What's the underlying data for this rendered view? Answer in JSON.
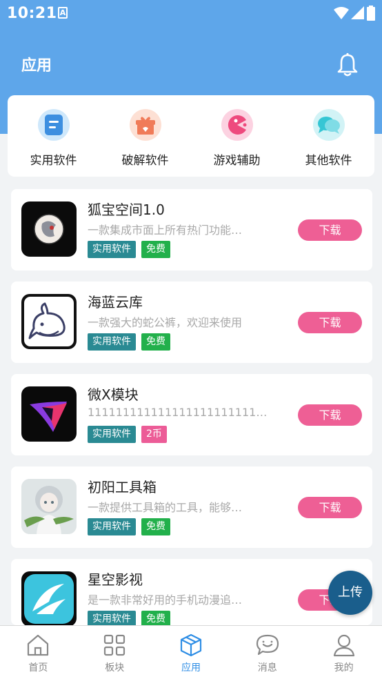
{
  "status_bar": {
    "time": "10:21",
    "notif_icon": "A"
  },
  "header": {
    "title": "应用"
  },
  "categories": [
    {
      "label": "实用软件",
      "icon": "doc-icon",
      "color": "#3d8fe0",
      "bg": "#cfe8fb"
    },
    {
      "label": "破解软件",
      "icon": "gift-icon",
      "color": "#f07b58",
      "bg": "#fde0d4"
    },
    {
      "label": "游戏辅助",
      "icon": "game-icon",
      "color": "#ee4a7e",
      "bg": "#fcd2e1"
    },
    {
      "label": "其他软件",
      "icon": "chat-icon",
      "color": "#35c6d4",
      "bg": "#d2f3f6"
    }
  ],
  "apps": [
    {
      "name": "狐宝空间1.0",
      "desc": "一款集成市面上所有热门功能…",
      "tag_category": "实用软件",
      "tag_price": "免费",
      "price_type": "free",
      "button": "下载"
    },
    {
      "name": "海蓝云库",
      "desc": "一款强大的蛇公裤，欢迎来使用",
      "tag_category": "实用软件",
      "tag_price": "免费",
      "price_type": "free",
      "button": "下载"
    },
    {
      "name": "微X模块",
      "desc": "1111111111111111111111111…",
      "tag_category": "实用软件",
      "tag_price": "2币",
      "price_type": "coin",
      "button": "下载"
    },
    {
      "name": "初阳工具箱",
      "desc": "一款提供工具箱的工具，能够…",
      "tag_category": "实用软件",
      "tag_price": "免费",
      "price_type": "free",
      "button": "下载"
    },
    {
      "name": "星空影视",
      "desc": "是一款非常好用的手机动漫追…",
      "tag_category": "实用软件",
      "tag_price": "免费",
      "price_type": "free",
      "button": "下载"
    }
  ],
  "fab": {
    "label": "上传"
  },
  "nav": [
    {
      "label": "首页",
      "icon": "home-icon",
      "active": false
    },
    {
      "label": "板块",
      "icon": "grid-icon",
      "active": false
    },
    {
      "label": "应用",
      "icon": "box-icon",
      "active": true
    },
    {
      "label": "消息",
      "icon": "message-icon",
      "active": false
    },
    {
      "label": "我的",
      "icon": "user-icon",
      "active": false
    }
  ],
  "colors": {
    "header": "#5ea6ea",
    "accent": "#2f8ee5",
    "download": "#ee5f95",
    "tag_category": "#2a8a93",
    "tag_free": "#22b04b",
    "tag_coin": "#ec5c97"
  }
}
